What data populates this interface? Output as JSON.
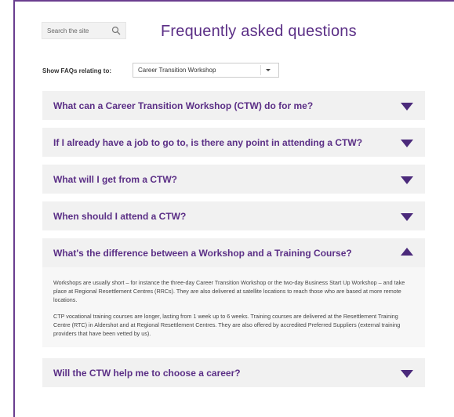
{
  "search": {
    "placeholder": "Search the site",
    "icon": "search-icon"
  },
  "page": {
    "title": "Frequently asked questions"
  },
  "filter": {
    "label": "Show FAQs relating to:",
    "selected": "Career Transition Workshop"
  },
  "faqs": [
    {
      "question": "What can a Career Transition Workshop (CTW) do for me?",
      "expanded": false
    },
    {
      "question": "If I already have a job to go to, is there any point in attending a CTW?",
      "expanded": false
    },
    {
      "question": "What will I get from a CTW?",
      "expanded": false
    },
    {
      "question": "When should I attend a CTW?",
      "expanded": false
    },
    {
      "question": "What's the difference between a Workshop and a Training Course?",
      "expanded": true,
      "answer": [
        "Workshops are usually short – for instance the three-day Career Transition Workshop or the two-day Business Start Up Workshop – and take place at Regional Resettlement Centres (RRCs). They are also delivered at satellite locations to reach those who are based at more remote locations.",
        "CTP vocational training courses are longer, lasting from 1 week up to 6 weeks. Training courses are delivered at the Resettlement Training Centre (RTC) in Aldershot and at Regional Resettlement Centres. They are also offered by accredited Preferred Suppliers (external training providers that have been vetted by us)."
      ]
    },
    {
      "question": "Will the CTW help me to choose a career?",
      "expanded": false
    }
  ],
  "colors": {
    "accent": "#5b2f86",
    "frame": "#6a3e8f",
    "panel": "#f1f1f1"
  }
}
